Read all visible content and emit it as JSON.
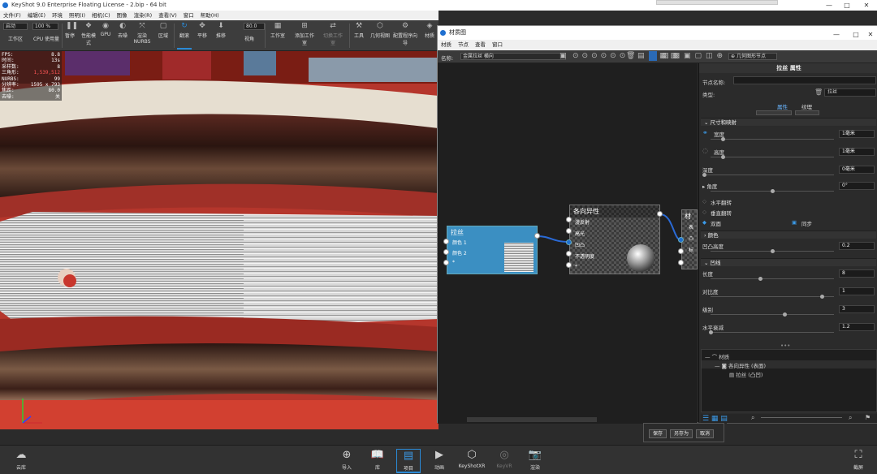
{
  "app_title": "KeyShot 9.0 Enterprise Floating License  -  2.bip  -  64 bit",
  "window_controls": [
    "—",
    "□",
    "✕"
  ],
  "menu": [
    "文件(F)",
    "编辑(E)",
    "环境",
    "照明(I)",
    "相机(C)",
    "图像",
    "渲染(R)",
    "查看(V)",
    "窗口",
    "帮助(H)"
  ],
  "toolbar": {
    "startup_label": "启动",
    "zoom_value": "100 %",
    "fov_value": "80.0",
    "items": [
      "工作区",
      "CPU 使用量",
      "暂停",
      "性能模式",
      "GPU",
      "去噪",
      "渲染NURBS",
      "区域",
      "翻滚",
      "平移",
      "推移",
      "视角",
      "工作室",
      "添加工作室",
      "切换工作室",
      "工具",
      "几何视图",
      "配置程序向导",
      "材质"
    ],
    "cpu_value": "全部",
    "active": "翻滚"
  },
  "stats": [
    {
      "k": "FPS:",
      "v": "8.8"
    },
    {
      "k": "时间:",
      "v": "13s"
    },
    {
      "k": "采样数:",
      "v": "8"
    },
    {
      "k": "三角形:",
      "v": "1,539,512",
      "red": true
    },
    {
      "k": "NURBS:",
      "v": "99"
    },
    {
      "k": "分辨率:",
      "v": "1595 x 793"
    },
    {
      "k": "焦距:",
      "v": "80.0"
    },
    {
      "k": "去噪:",
      "v": "关"
    }
  ],
  "material_graph": {
    "title": "材质图",
    "menu": [
      "材质",
      "节点",
      "查看",
      "窗口"
    ],
    "name_label": "名称:",
    "name_value": "金属拉丝 横向",
    "geometry_node_button": "几何图形节点",
    "nodes": {
      "brush": {
        "title": "拉丝",
        "ports": [
          "颜色 1",
          "颜色 2",
          "*"
        ]
      },
      "aniso": {
        "title": "各向异性",
        "ports": [
          "漫反射",
          "高光",
          "凹凸",
          "不透明度",
          "*"
        ]
      },
      "material": {
        "title": "材",
        "ports": [
          "表",
          "凸",
          "标"
        ]
      }
    }
  },
  "properties": {
    "header": "拉丝 属性",
    "node_name_label": "节点名称:",
    "type_label": "类型:",
    "type_value": "拉丝",
    "tabs": [
      "属性",
      "纹理"
    ],
    "size_section": "尺寸和映射",
    "fields": [
      {
        "label": "宽度",
        "value": "1毫米",
        "knob": 0.1
      },
      {
        "label": "高度",
        "value": "1毫米",
        "knob": 0.1
      },
      {
        "label": "深度",
        "value": "0毫米",
        "knob": 0.0
      },
      {
        "label": "角度",
        "value": "0°",
        "knob": 0.5
      }
    ],
    "flip_h": "水平翻转",
    "flip_v": "垂直翻转",
    "two_sided": "双面",
    "sync": "同步",
    "color_section": "颜色",
    "bump_label": "凹凸高度",
    "bump_value": "0.2",
    "bump_knob": 0.5,
    "noise_section": "凹线",
    "noise_fields": [
      {
        "label": "长度",
        "value": "8",
        "knob": 0.4
      },
      {
        "label": "对比度",
        "value": "1",
        "knob": 0.9
      },
      {
        "label": "级别",
        "value": "3",
        "knob": 0.6
      },
      {
        "label": "水平衰减",
        "value": "1.2",
        "knob": 0.0
      }
    ],
    "tree": [
      "材质",
      "各向异性 (表面)",
      "拉丝 (凸凹)"
    ]
  },
  "dialog_buttons": [
    "保存",
    "另存为",
    "取消"
  ],
  "dock": {
    "left": "云库",
    "right": "截屏",
    "items": [
      "导入",
      "库",
      "项目",
      "动画",
      "KeyShotXR",
      "KeyVR",
      "渲染"
    ],
    "active": "项目"
  },
  "colors": {
    "accent": "#2a8ad6",
    "brush_node": "#3b8fc2",
    "viewport": "#c9322a"
  }
}
